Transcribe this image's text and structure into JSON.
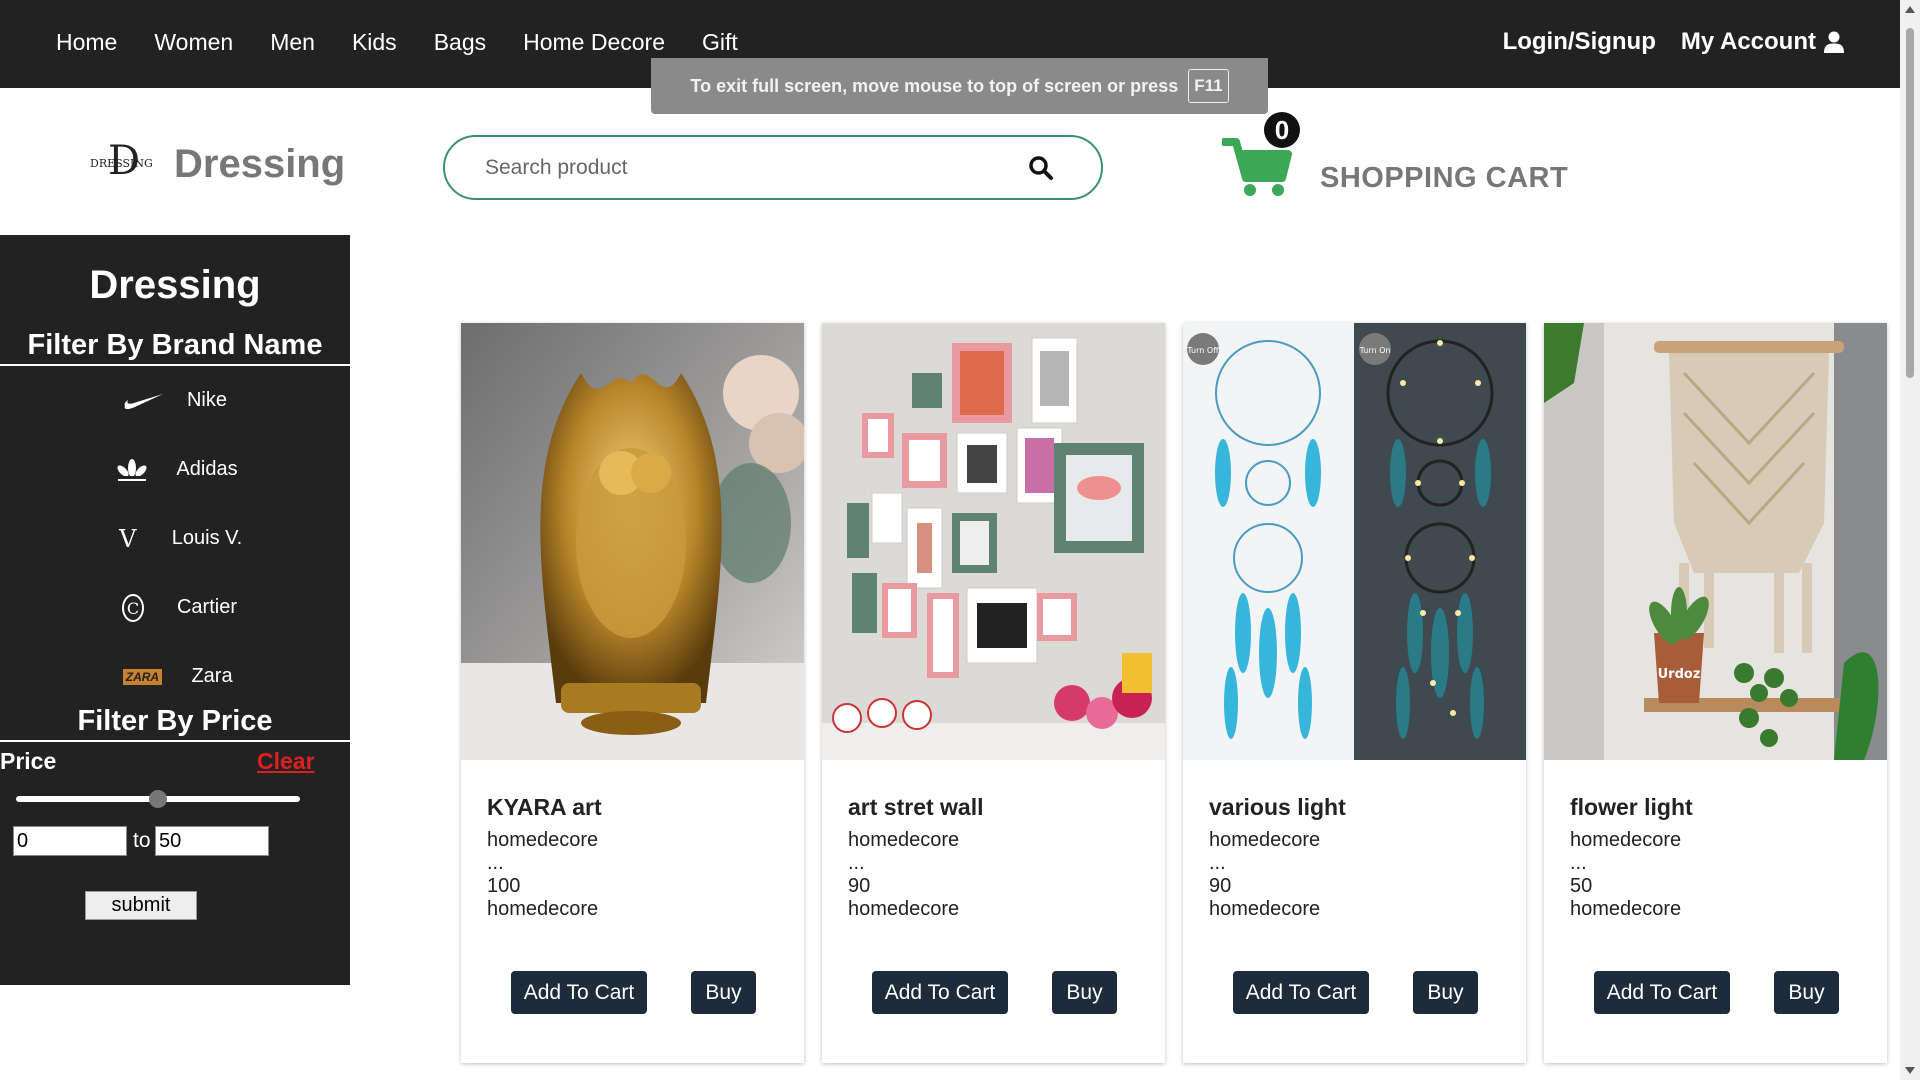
{
  "nav": {
    "links": [
      "Home",
      "Women",
      "Men",
      "Kids",
      "Bags",
      "Home Decore",
      "Gift"
    ],
    "login": "Login/Signup",
    "account": "My Account"
  },
  "fullscreen_toast": {
    "text": "To exit full screen, move mouse to top of screen or press",
    "key": "F11"
  },
  "logo": {
    "mark_big": "D",
    "mark_small": "DRESSING",
    "name": "Dressing"
  },
  "search": {
    "placeholder": "Search product"
  },
  "cart": {
    "count": "0",
    "label": "SHOPPING CART"
  },
  "sidebar": {
    "title": "Dressing",
    "brand_filter_title": "Filter By Brand Name",
    "brands": [
      {
        "name": "Nike",
        "icon": "nike-swoosh-icon"
      },
      {
        "name": "Adidas",
        "icon": "adidas-trefoil-icon"
      },
      {
        "name": "Louis V.",
        "icon": "louis-vuitton-icon"
      },
      {
        "name": "Cartier",
        "icon": "cartier-icon"
      },
      {
        "name": "Zara",
        "icon": "zara-icon"
      }
    ],
    "louis_glyph": "V",
    "cartier_glyph": "C",
    "zara_glyph": "ZARA",
    "price_filter_title": "Filter By Price",
    "price_label": "Price",
    "clear_label": "Clear",
    "slider_value_fraction": 0.5,
    "min_value": "0",
    "to_label": "to",
    "max_value": "50",
    "submit_label": "submit"
  },
  "products": [
    {
      "name": "KYARA art",
      "category": "homedecore",
      "desc": "...",
      "price": "100",
      "tag": "homedecore",
      "add_label": "Add To Cart",
      "buy_label": "Buy"
    },
    {
      "name": "art stret wall",
      "category": "homedecore",
      "desc": "...",
      "price": "90",
      "tag": "homedecore",
      "add_label": "Add To Cart",
      "buy_label": "Buy"
    },
    {
      "name": "various light",
      "category": "homedecore",
      "desc": "...",
      "price": "90",
      "tag": "homedecore",
      "add_label": "Add To Cart",
      "buy_label": "Buy",
      "img_labels": [
        "Turn Off",
        "Turn On"
      ]
    },
    {
      "name": "flower light",
      "category": "homedecore",
      "desc": "...",
      "price": "50",
      "tag": "homedecore",
      "add_label": "Add To Cart",
      "buy_label": "Buy",
      "img_label": "Urdoz"
    }
  ],
  "colors": {
    "nav_bg": "#222223",
    "accent_green": "#3aa856",
    "search_border": "#3a8f6e",
    "button_bg": "#1d2b3a",
    "clear_red": "#e02020"
  }
}
